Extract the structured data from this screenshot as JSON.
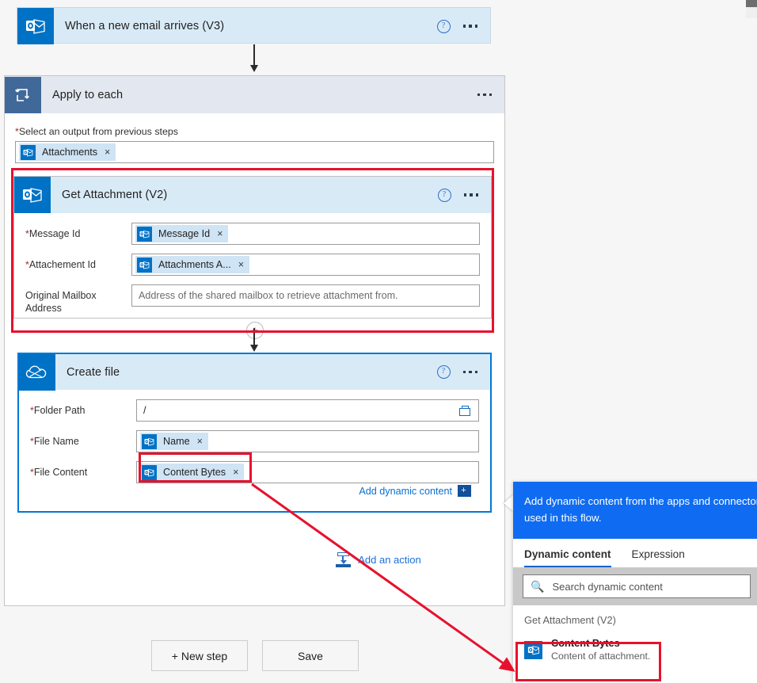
{
  "trigger": {
    "title": "When a new email arrives (V3)",
    "icon": "outlook-icon",
    "help": "?"
  },
  "loop": {
    "title": "Apply to each",
    "icon": "loop-icon",
    "output_label": "Select an output from previous steps",
    "output_token": "Attachments",
    "token_remove": "×"
  },
  "get_attachment": {
    "title": "Get Attachment (V2)",
    "help": "?",
    "rows": [
      {
        "label": "Message Id",
        "required": true,
        "type": "token",
        "value": "Message Id"
      },
      {
        "label": "Attachement Id",
        "required": true,
        "type": "token",
        "value": "Attachments A..."
      },
      {
        "label": "Original Mailbox Address",
        "required": false,
        "type": "placeholder",
        "value": "Address of the shared mailbox to retrieve attachment from."
      }
    ]
  },
  "create_file": {
    "title": "Create file",
    "help": "?",
    "rows": [
      {
        "label": "Folder Path",
        "required": true,
        "type": "text",
        "value": "/"
      },
      {
        "label": "File Name",
        "required": true,
        "type": "token",
        "value": "Name"
      },
      {
        "label": "File Content",
        "required": true,
        "type": "token",
        "value": "Content Bytes"
      }
    ],
    "add_dynamic_content": "Add dynamic content",
    "add_dynamic_content_btn": "+"
  },
  "add_action": {
    "label": "Add an action"
  },
  "footer": {
    "new_step": "+ New step",
    "save": "Save"
  },
  "dynamic_panel": {
    "header_line1": "Add dynamic content from the apps and connector",
    "header_line2": "used in this flow.",
    "tabs": [
      {
        "label": "Dynamic content",
        "active": true
      },
      {
        "label": "Expression",
        "active": false
      }
    ],
    "search_placeholder": "Search dynamic content",
    "search_icon": "search-icon",
    "group": "Get Attachment (V2)",
    "items": [
      {
        "title": "Content Bytes",
        "subtitle": "Content of attachment.",
        "icon": "outlook-icon"
      }
    ]
  },
  "colors": {
    "accent_blue": "#0078d4",
    "outlook_blue": "#0072c6",
    "loop_slate": "#40699a",
    "panel_blue": "#0f6cf2",
    "annotation_red": "#e8112d",
    "card_header_blue": "#d9eaf7",
    "token_blue": "#cfe4f5"
  }
}
